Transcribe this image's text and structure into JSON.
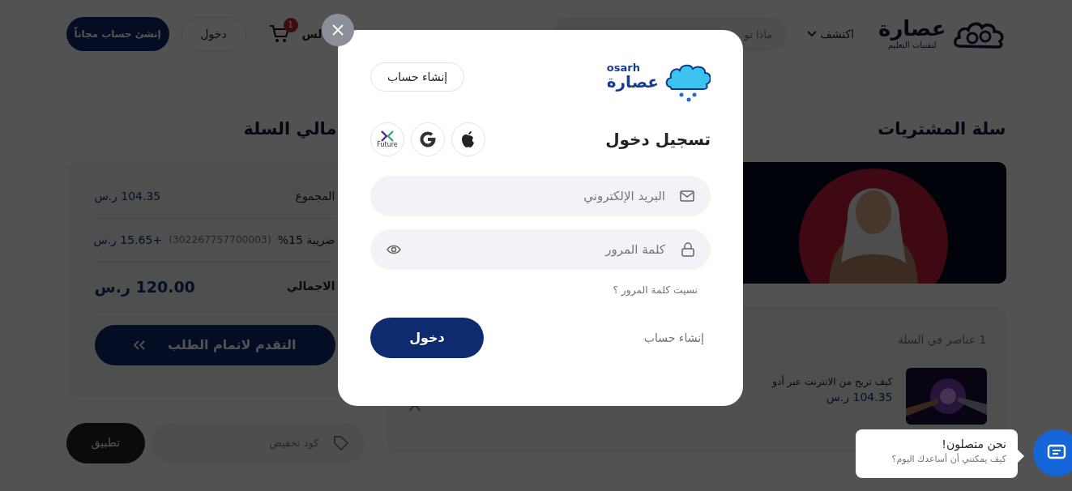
{
  "header": {
    "logo": {
      "name": "عصارة",
      "tagline": "لتقنيات التعليم"
    },
    "nav": [
      {
        "label": "اكتشف",
        "kind": "dropdown"
      }
    ],
    "search": {
      "placeholder": "ماذا تو"
    },
    "nav_fragment": "لس",
    "cart_count": "1",
    "login": "دخول",
    "signup": "إنشئ حساب مجاناً"
  },
  "cart": {
    "title": "سلة المشتريات",
    "items_count": "1 عناصر في السلة",
    "items": [
      {
        "title": "كيف تربح من الانترنت عبر أدو",
        "price": "104.35 ر.س"
      }
    ]
  },
  "summary": {
    "title": "مالي السلة",
    "rows": [
      {
        "label": "المجموع",
        "value": "104.35 ر.س",
        "kind": "normal"
      },
      {
        "label": "ضريبة 15%",
        "note": "(302267757700003)",
        "value": "+15.65 ر.س",
        "kind": "normal"
      },
      {
        "label": "الاجمالي",
        "value": "120.00 ر.س",
        "kind": "total"
      }
    ],
    "checkout": "التقدم لاتمام الطلب",
    "coupon": {
      "placeholder": "كود تخفيض"
    },
    "apply": "تطبيق"
  },
  "modal": {
    "logo": {
      "latin": "osarh",
      "arabic": "عصارة"
    },
    "signup_button": "إنشاء حساب",
    "title": "تسجيل دخول",
    "social": [
      {
        "kind": "apple"
      },
      {
        "kind": "google"
      },
      {
        "kind": "future",
        "label": "Future"
      }
    ],
    "email": {
      "placeholder": "البريد الإلكتروني"
    },
    "password": {
      "placeholder": "كلمة المرور"
    },
    "forgot": "نسيت كلمة المرور ؟",
    "login": "دخول",
    "signup_link": "إنشاء حساب"
  },
  "chat": {
    "title": "نحن متصلون!",
    "subtitle": "كيف يمكنني أن أساعدك اليوم؟"
  }
}
